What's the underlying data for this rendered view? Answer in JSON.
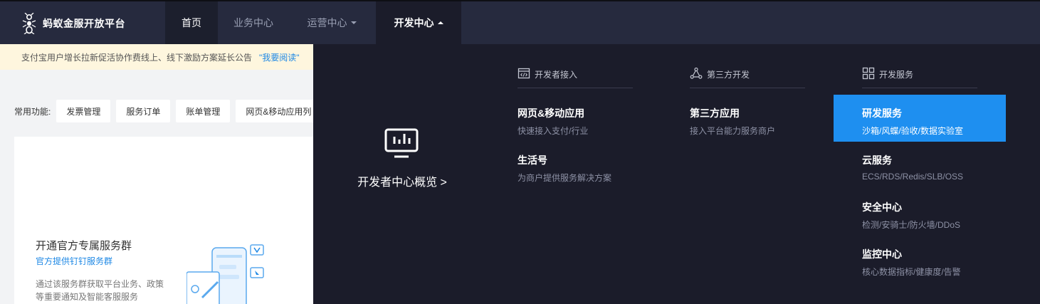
{
  "brand": {
    "name": "蚂蚁金服开放平台",
    "logo_icon": "ant-logo-icon"
  },
  "nav": {
    "home": "首页",
    "business": "业务中心",
    "operations": "运营中心",
    "developer": "开发中心"
  },
  "notice": {
    "text": "支付宝用户增长拉新促活协作费线上、线下激励方案延长公告",
    "link": "\"我要阅读\""
  },
  "quick": {
    "label": "常用功能:",
    "items": [
      "发票管理",
      "服务订单",
      "账单管理",
      "网页&移动应用列"
    ]
  },
  "card": {
    "title": "开通官方专属服务群",
    "subtitle": "官方提供钉钉服务群",
    "desc": "通过该服务群获取平台业务、政策等重要通知及智能客服服务"
  },
  "mega": {
    "overview": "开发者中心概览 >",
    "columns": [
      {
        "heading": "开发者接入",
        "icon": "code-window-icon",
        "items": [
          {
            "title": "网页&移动应用",
            "sub": "快速接入支付/行业"
          },
          {
            "title": "生活号",
            "sub": "为商户提供服务解决方案"
          }
        ]
      },
      {
        "heading": "第三方开发",
        "icon": "network-triangle-icon",
        "items": [
          {
            "title": "第三方应用",
            "sub": "接入平台能力服务商户"
          }
        ]
      },
      {
        "heading": "开发服务",
        "icon": "grid-apps-icon",
        "items": [
          {
            "title": "研发服务",
            "sub": "沙箱/风蝶/验收/数据实验室"
          },
          {
            "title": "云服务",
            "sub": "ECS/RDS/Redis/SLB/OSS"
          },
          {
            "title": "安全中心",
            "sub": "检测/安骑士/防火墙/DDoS"
          },
          {
            "title": "监控中心",
            "sub": "核心数据指标/健康度/告警"
          }
        ]
      }
    ]
  },
  "colors": {
    "nav_bg": "#262a3e",
    "menu_bg": "#1b1c2a",
    "accent": "#1e8ff0",
    "notice_bg": "#fef6de"
  }
}
